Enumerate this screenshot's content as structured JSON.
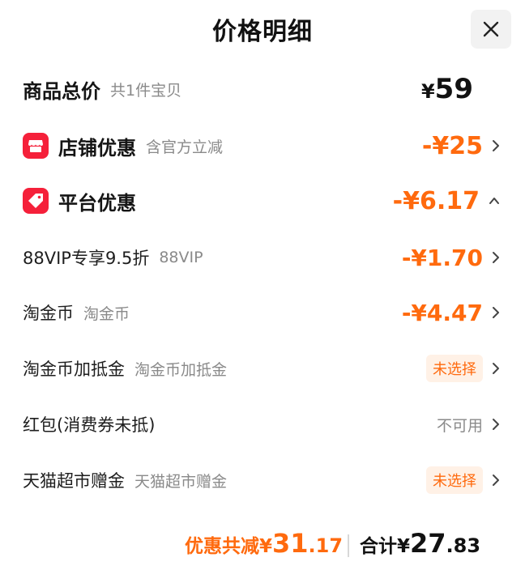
{
  "header": {
    "title": "价格明细",
    "close_icon": "close-icon"
  },
  "total": {
    "label": "商品总价",
    "note": "共1件宝贝",
    "yen": "¥",
    "amount": "59"
  },
  "shop_discount": {
    "label": "店铺优惠",
    "note": "含官方立减",
    "amount": "-¥25",
    "icon": "store-icon"
  },
  "platform_discount": {
    "label": "平台优惠",
    "amount": "-¥6.17",
    "icon": "tag-icon",
    "expanded": true
  },
  "details": [
    {
      "label": "88VIP专享9.5折",
      "note": "88VIP",
      "value": "-¥1.70",
      "kind": "amount"
    },
    {
      "label": "淘金币",
      "note": "淘金币",
      "value": "-¥4.47",
      "kind": "amount"
    },
    {
      "label": "淘金币加抵金",
      "note": "淘金币加抵金",
      "value": "未选择",
      "kind": "pill"
    },
    {
      "label": "红包(消费券未抵)",
      "note": "",
      "value": "不可用",
      "kind": "na"
    },
    {
      "label": "天猫超市赠金",
      "note": "天猫超市赠金",
      "value": "未选择",
      "kind": "pill"
    }
  ],
  "footer": {
    "discount_label": "优惠共减",
    "discount_yen": "¥",
    "discount_int": "31",
    "discount_dec": ".17",
    "total_label": "合计",
    "total_yen": "¥",
    "total_int": "27",
    "total_dec": ".83"
  },
  "colors": {
    "accent": "#ff6a0e",
    "badge": "#f5203a",
    "pill_bg": "#fff1e6",
    "muted": "#8a8a8a"
  }
}
